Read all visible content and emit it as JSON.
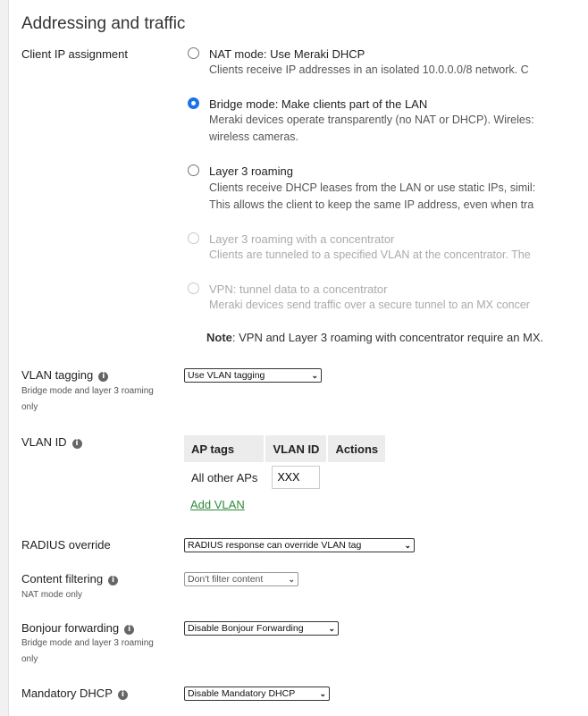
{
  "section_title": "Addressing and traffic",
  "client_ip": {
    "label": "Client IP assignment",
    "options": [
      {
        "title": "NAT mode: Use Meraki DHCP",
        "desc": [
          "Clients receive IP addresses in an isolated 10.0.0.0/8 network. C"
        ]
      },
      {
        "title": "Bridge mode: Make clients part of the LAN",
        "desc": [
          "Meraki devices operate transparently (no NAT or DHCP). Wireles:",
          "wireless cameras."
        ]
      },
      {
        "title": "Layer 3 roaming",
        "desc": [
          "Clients receive DHCP leases from the LAN or use static IPs, simil:",
          "This allows the client to keep the same IP address, even when tra"
        ]
      },
      {
        "title": "Layer 3 roaming with a concentrator",
        "desc": [
          "Clients are tunneled to a specified VLAN at the concentrator. The"
        ]
      },
      {
        "title": "VPN: tunnel data to a concentrator",
        "desc": [
          "Meraki devices send traffic over a secure tunnel to an MX concer"
        ]
      }
    ],
    "selected_index": 1,
    "note_bold": "Note",
    "note_text": ": VPN and Layer 3 roaming with concentrator require an MX."
  },
  "vlan_tagging": {
    "label": "VLAN tagging",
    "sub": "Bridge mode and layer 3 roaming only",
    "value": "Use VLAN tagging"
  },
  "vlan_id": {
    "label": "VLAN ID",
    "headers": [
      "AP tags",
      "VLAN ID",
      "Actions"
    ],
    "row_label": "All other APs",
    "input_value": "XXX",
    "add_label": "Add VLAN"
  },
  "radius_override": {
    "label": "RADIUS override",
    "value": "RADIUS response can override VLAN tag"
  },
  "content_filtering": {
    "label": "Content filtering",
    "sub": "NAT mode only",
    "value": "Don't filter content"
  },
  "bonjour": {
    "label": "Bonjour forwarding",
    "sub": "Bridge mode and layer 3 roaming only",
    "value": "Disable Bonjour Forwarding"
  },
  "mandatory_dhcp": {
    "label": "Mandatory DHCP",
    "value": "Disable Mandatory DHCP"
  },
  "icons": {
    "info": "info-icon",
    "chevron": "chevron-down-icon"
  }
}
